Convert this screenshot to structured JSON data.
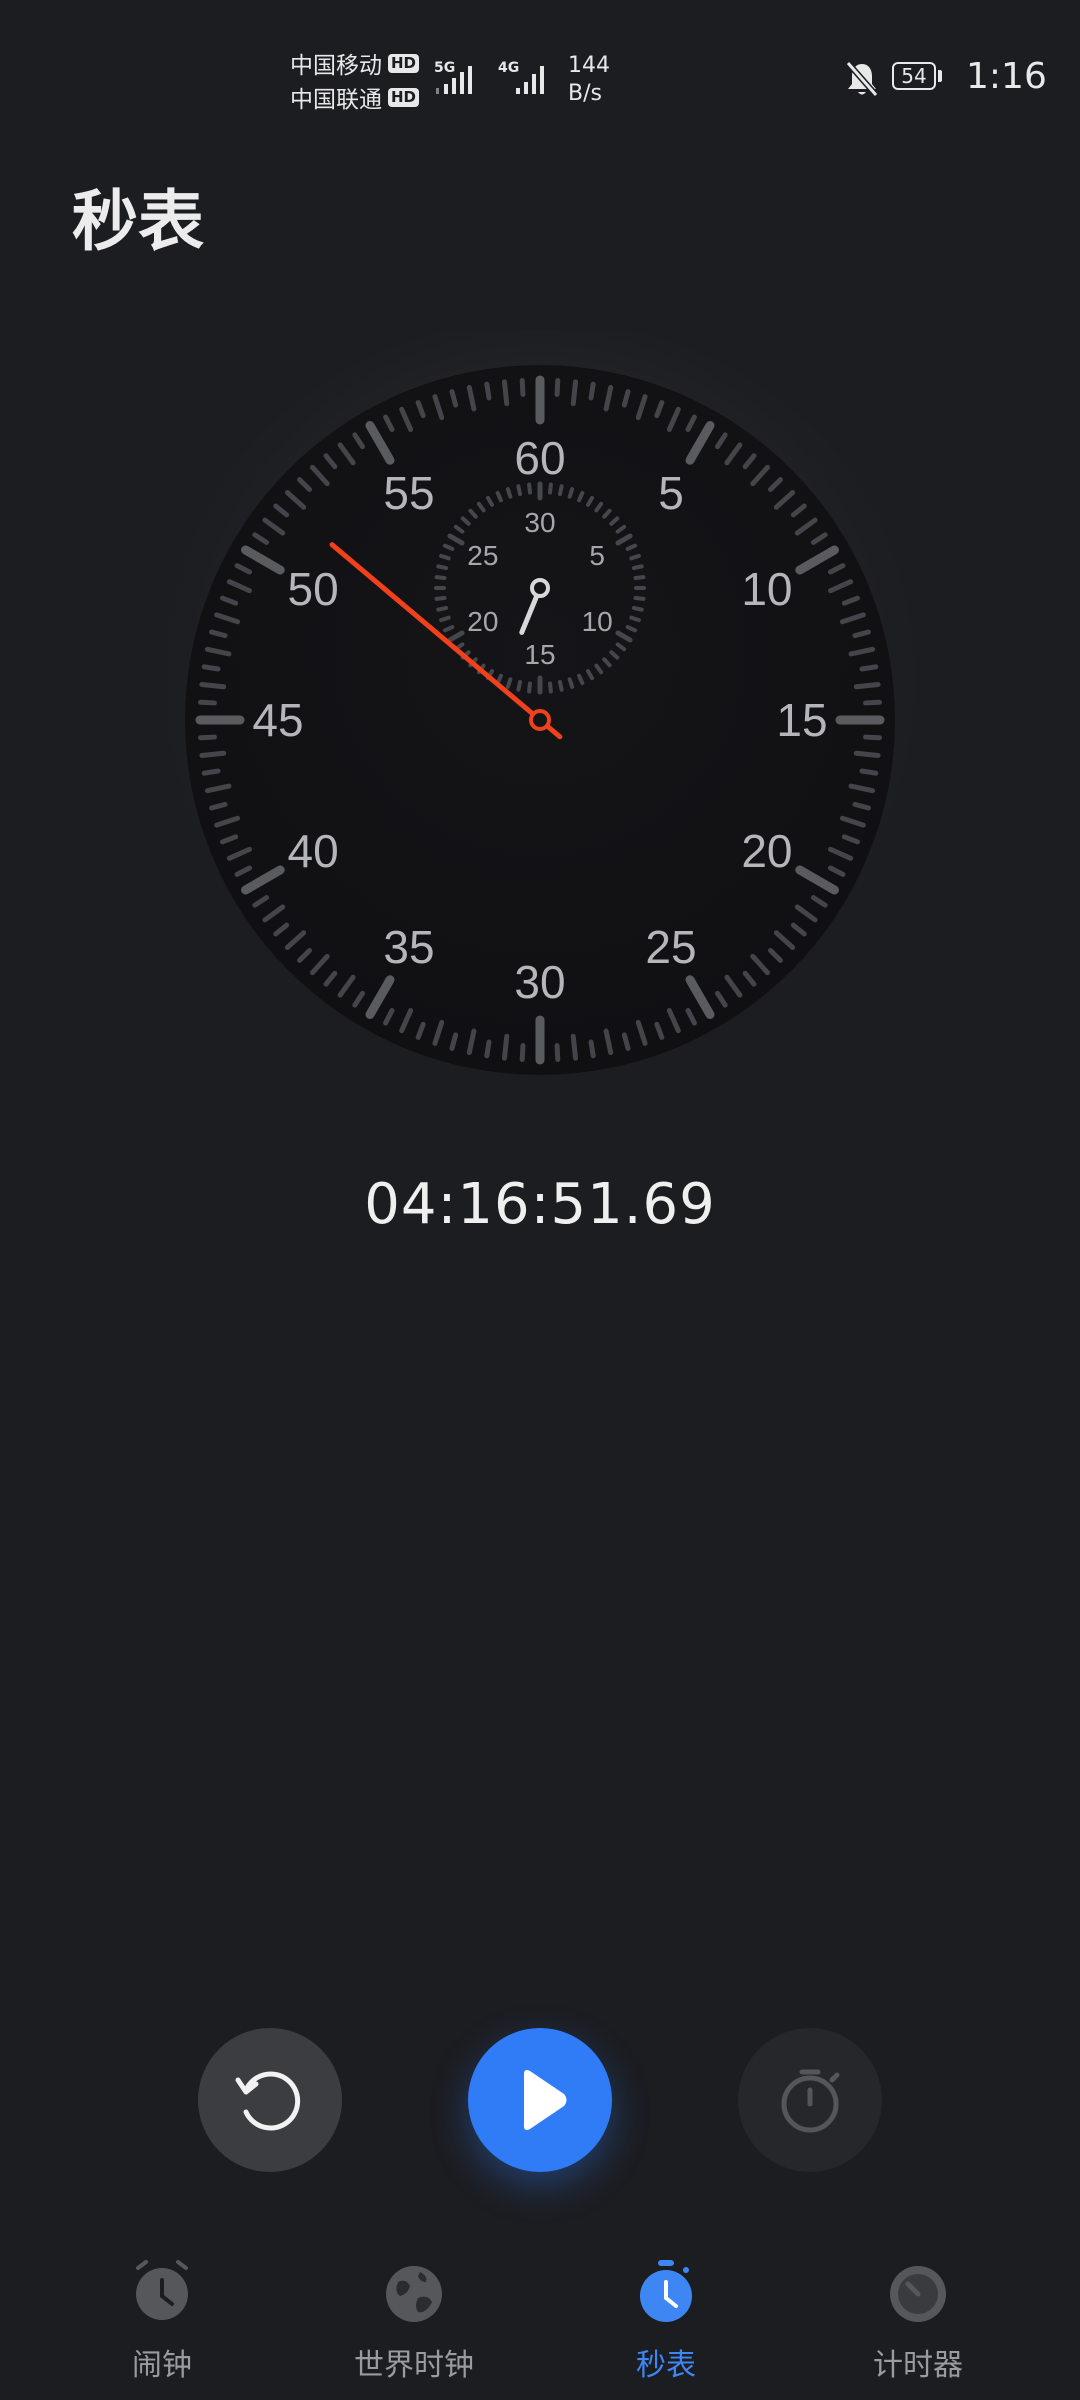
{
  "status_bar": {
    "carrier_1": "中国移动",
    "carrier_2": "中国联通",
    "hd_badge": "HD",
    "network_1": "5G",
    "network_2": "4G",
    "speed_value": "144",
    "speed_unit": "B/s",
    "battery_level": "54",
    "time": "1:16",
    "icons": [
      "signal-icon",
      "bell-muted-icon",
      "battery-icon"
    ]
  },
  "header": {
    "title": "秒表"
  },
  "stopwatch": {
    "dial_labels": [
      "60",
      "5",
      "10",
      "15",
      "20",
      "25",
      "30",
      "35",
      "40",
      "45",
      "50",
      "55"
    ],
    "sub_dial_labels": [
      "30",
      "5",
      "10",
      "15",
      "20",
      "25"
    ],
    "second_hand_value": 51.69,
    "sub_dial_minutes": 16.86,
    "hand_color": "#f0401c",
    "elapsed": "04:16:51.69"
  },
  "controls": {
    "reset_icon": "reset-icon",
    "play_icon": "play-icon",
    "lap_icon": "stopwatch-icon",
    "accent": "#2f7cf6"
  },
  "nav": {
    "items": [
      {
        "label": "闹钟",
        "icon": "alarm-icon",
        "active": false
      },
      {
        "label": "世界时钟",
        "icon": "globe-icon",
        "active": false
      },
      {
        "label": "秒表",
        "icon": "stopwatch-icon",
        "active": true
      },
      {
        "label": "计时器",
        "icon": "timer-icon",
        "active": false
      }
    ],
    "active_color": "#3f86f5"
  }
}
